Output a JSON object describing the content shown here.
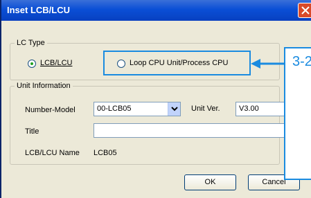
{
  "window": {
    "title": "Inset LCB/LCU"
  },
  "lc_type": {
    "legend": "LC Type",
    "option_lcb_lcu": {
      "label": "LCB/LCU",
      "selected": true
    },
    "option_loop_cpu": {
      "label": "Loop CPU Unit/Process CPU",
      "selected": false
    }
  },
  "unit_info": {
    "legend": "Unit Information",
    "number_model_label": "Number-Model",
    "number_model_value": "00-LCB05",
    "unit_ver_label": "Unit Ver.",
    "unit_ver_value": "V3.00",
    "title_label": "Title",
    "title_value": "",
    "name_label": "LCB/LCU Name",
    "name_value": "LCB05"
  },
  "buttons": {
    "ok": "OK",
    "cancel": "Cancel"
  },
  "annotation": {
    "callout_text": "3-2",
    "color": "#1a8be0"
  },
  "icons": {
    "close": "close-icon",
    "dropdown": "chevron-down-icon",
    "callout_arrow": "arrow-left-icon"
  }
}
